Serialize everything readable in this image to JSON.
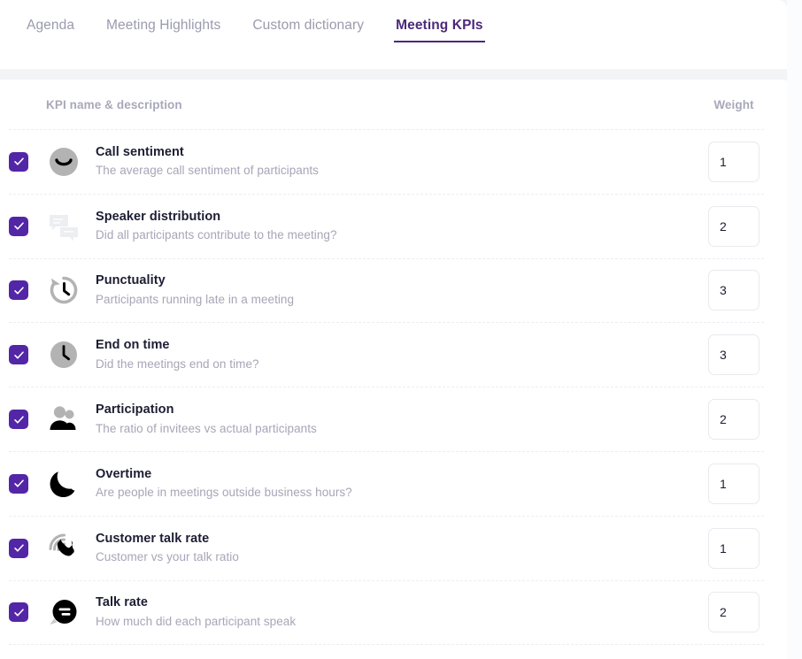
{
  "tabs": [
    {
      "label": "Agenda",
      "active": false
    },
    {
      "label": "Meeting Highlights",
      "active": false
    },
    {
      "label": "Custom dictionary",
      "active": false
    },
    {
      "label": "Meeting KPIs",
      "active": true
    }
  ],
  "table": {
    "columns": {
      "name": "KPI name & description",
      "weight": "Weight"
    },
    "rows": [
      {
        "icon": "smiley-face-icon",
        "title": "Call sentiment",
        "description": "The average call sentiment of participants",
        "weight": "1",
        "checked": true
      },
      {
        "icon": "chat-bubbles-icon",
        "title": "Speaker distribution",
        "description": "Did all participants contribute to the meeting?",
        "weight": "2",
        "checked": true
      },
      {
        "icon": "clock-rewind-icon",
        "title": "Punctuality",
        "description": "Participants running late in a meeting",
        "weight": "3",
        "checked": true
      },
      {
        "icon": "clock-icon",
        "title": "End on time",
        "description": "Did the meetings end on time?",
        "weight": "3",
        "checked": true
      },
      {
        "icon": "people-icon",
        "title": "Participation",
        "description": "The ratio of invitees vs actual participants",
        "weight": "2",
        "checked": true
      },
      {
        "icon": "moon-icon",
        "title": "Overtime",
        "description": "Are people in meetings outside business hours?",
        "weight": "1",
        "checked": true
      },
      {
        "icon": "phone-ringing-icon",
        "title": "Customer talk rate",
        "description": "Customer vs your talk ratio",
        "weight": "1",
        "checked": true
      },
      {
        "icon": "speech-bubble-lines-icon",
        "title": "Talk rate",
        "description": "How much did each participant speak",
        "weight": "2",
        "checked": true
      }
    ]
  },
  "colors": {
    "accent": "#5226a6",
    "active_tab": "#4b2a7b",
    "title_text": "#1d1d33",
    "muted_text": "#a6a6b8",
    "icon_gray": "#b3b3b3",
    "icon_light": "#eceef1",
    "icon_dark": "#000000",
    "card_bg": "#ffffff",
    "page_bg": "#f2f4f6"
  }
}
